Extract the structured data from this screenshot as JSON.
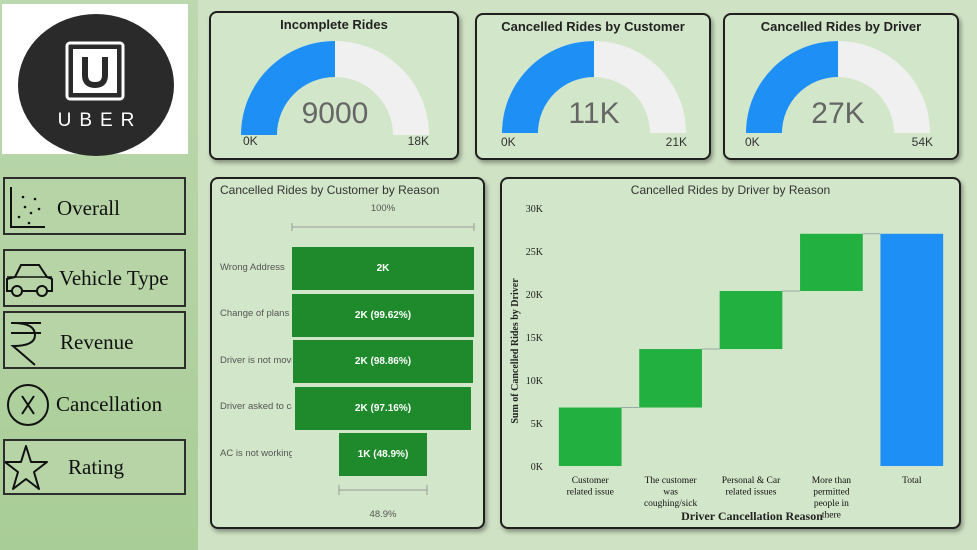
{
  "logo": {
    "word": "UBER"
  },
  "nav": [
    {
      "label": "Overall",
      "icon": "scatter-chart-icon"
    },
    {
      "label": "Vehicle Type",
      "icon": "car-icon"
    },
    {
      "label": "Revenue",
      "icon": "rupee-icon"
    },
    {
      "label": "Cancellation",
      "icon": "x-circle-icon"
    },
    {
      "label": "Rating",
      "icon": "star-icon"
    }
  ],
  "gauges": [
    {
      "title": "Incomplete Rides",
      "value_label": "9000",
      "min_label": "0K",
      "max_label": "18K",
      "value": 9000,
      "max": 18000
    },
    {
      "title": "Cancelled Rides by Customer",
      "value_label": "11K",
      "min_label": "0K",
      "max_label": "21K",
      "value": 10500,
      "max": 21000
    },
    {
      "title": "Cancelled Rides by Driver",
      "value_label": "27K",
      "min_label": "0K",
      "max_label": "54K",
      "value": 27000,
      "max": 54000
    }
  ],
  "funnel": {
    "title": "Cancelled Rides by Customer by Reason",
    "top_label": "100%",
    "bottom_label": "48.9%",
    "rows": [
      {
        "label": "Wrong Address",
        "value_label": "2K",
        "pct": 100
      },
      {
        "label": "Change of plans",
        "value_label": "2K (99.62%)",
        "pct": 99.62
      },
      {
        "label": "Driver is not moving towards pickup location",
        "value_label": "2K (98.86%)",
        "pct": 98.86
      },
      {
        "label": "Driver asked to cancel",
        "value_label": "2K (97.16%)",
        "pct": 97.16
      },
      {
        "label": "AC is not working",
        "value_label": "1K (48.9%)",
        "pct": 48.9
      }
    ]
  },
  "colors": {
    "green": "#1e8a2c",
    "waterfall_green": "#22b141",
    "blue": "#1e8ff5",
    "gauge_track": "#f0f0f0"
  },
  "chart_data": {
    "type": "bar",
    "subtype": "waterfall",
    "title": "Cancelled Rides by Driver by Reason",
    "xlabel": "Driver Cancellation Reason",
    "ylabel": "Sum of Cancelled Rides by Driver",
    "ylim": [
      0,
      30000
    ],
    "y_ticks": [
      "0K",
      "5K",
      "10K",
      "15K",
      "20K",
      "25K",
      "30K"
    ],
    "categories": [
      "Customer related issue",
      "The customer was coughing/sick",
      "Personal & Car related issues",
      "More than permitted people in there",
      "Total"
    ],
    "values": [
      6800,
      6800,
      6750,
      6650,
      27000
    ]
  }
}
